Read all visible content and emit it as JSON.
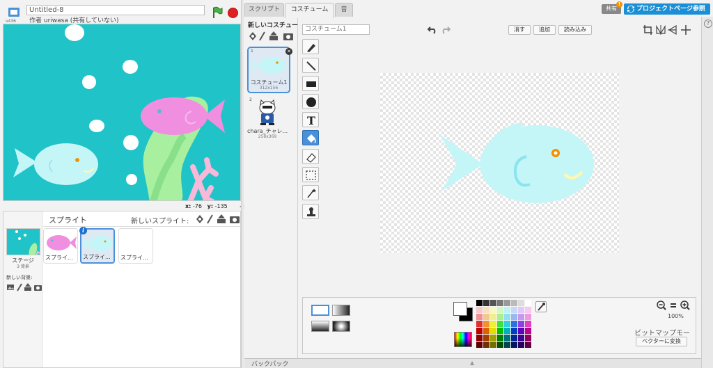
{
  "project": {
    "title": "Untitled-8",
    "author": "作者 uriwasa (共有していない)"
  },
  "stage": {
    "background_color": "#20c4c8",
    "mouse_x_label": "x:",
    "mouse_x_value": "-76",
    "mouse_y_label": "y:",
    "mouse_y_value": "-135"
  },
  "sprite_pane": {
    "title": "スプライト",
    "new_sprite_label": "新しいスプライト:",
    "stage_label": "ステージ",
    "backdrop_count": "3 背景",
    "new_backdrop_label": "新しい背景:",
    "sprites": [
      {
        "name": "スプライ..."
      },
      {
        "name": "スプライ...",
        "selected": true
      },
      {
        "name": "スプライ..."
      }
    ]
  },
  "tabs": [
    {
      "label": "スクリプト"
    },
    {
      "label": "コスチューム",
      "active": true
    },
    {
      "label": "音"
    }
  ],
  "header": {
    "share_label": "共有",
    "share_badge": "!",
    "project_page_label": "プロジェクトページ参照"
  },
  "costumes": {
    "new_costume_label": "新しいコスチューム:",
    "items": [
      {
        "number": "1",
        "name": "コスチューム1",
        "size": "312x156",
        "selected": true
      },
      {
        "number": "2",
        "name": "chara_チャレ...",
        "size": "258x369"
      }
    ]
  },
  "editor": {
    "costume_name": "コスチューム1",
    "clear_label": "消す",
    "add_label": "追加",
    "import_label": "読み込み",
    "zoom_level": "100%",
    "mode_label": "ビットマップモード",
    "convert_label": "ベクターに変換",
    "accent_color": "#4a90d9"
  },
  "backpack": {
    "label": "バックパック"
  }
}
